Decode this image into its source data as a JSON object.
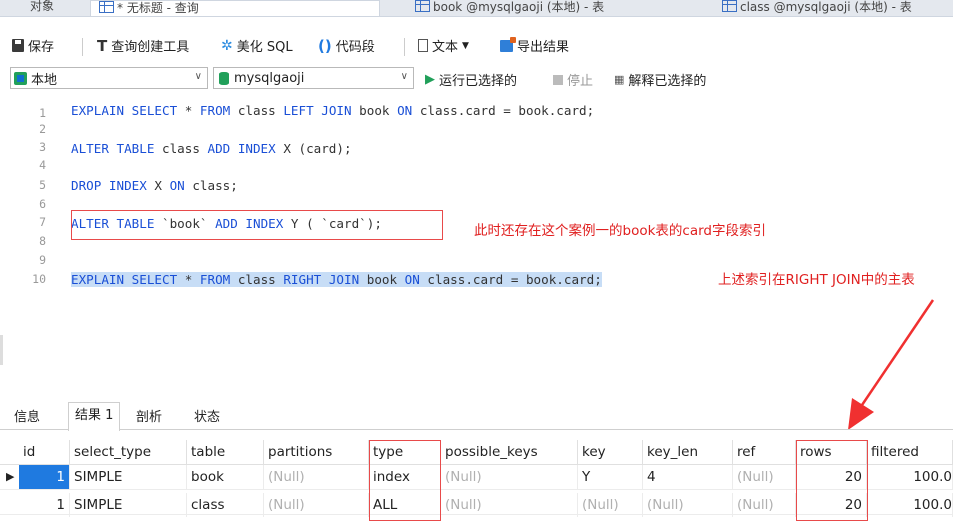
{
  "tabs": [
    {
      "label": "对象"
    },
    {
      "label": "* 无标题 - 查询"
    },
    {
      "label": "book @mysqlgaoji (本地) - 表"
    },
    {
      "label": "class @mysqlgaoji (本地) - 表"
    }
  ],
  "toolbar": {
    "save": "保存",
    "query_builder": "查询创建工具",
    "beautify": "美化 SQL",
    "snippet": "代码段",
    "text": "文本",
    "export": "导出结果"
  },
  "connbar": {
    "connection": "本地",
    "database": "mysqlgaoji",
    "run": "运行已选择的",
    "stop": "停止",
    "explain": "解释已选择的"
  },
  "editor": {
    "line_numbers": [
      "1",
      "2",
      "3",
      "4",
      "5",
      "6",
      "7",
      "8",
      "9",
      "10"
    ],
    "lines": {
      "l1": {
        "k1": "EXPLAIN SELECT",
        "t1": " * ",
        "k2": "FROM",
        "t2": " class ",
        "k3": "LEFT JOIN",
        "t3": " book ",
        "k4": "ON",
        "t4": " class.card = book.card;"
      },
      "l3": {
        "k1": "ALTER TABLE",
        "t1": " class ",
        "k2": "ADD INDEX",
        "t2": " X (card);"
      },
      "l5": {
        "k1": "DROP INDEX",
        "t1": " X ",
        "k2": "ON",
        "t2": " class;"
      },
      "l7": {
        "k1": "ALTER TABLE",
        "t1": " `book` ",
        "k2": "ADD INDEX",
        "t2": " Y ( `card`);"
      },
      "l10": {
        "k1": "EXPLAIN SELECT",
        "t1": " * ",
        "k2": "FROM",
        "t2": " class ",
        "k3": "RIGHT JOIN",
        "t3": " book ",
        "k4": "ON",
        "t4": " class.card = book.card;"
      }
    },
    "annotation1": "此时还存在这个案例一的book表的card字段索引",
    "annotation2": "上述索引在RIGHT JOIN中的主表"
  },
  "result_tabs": [
    "信息",
    "结果 1",
    "剖析",
    "状态"
  ],
  "grid": {
    "columns": [
      "id",
      "select_type",
      "table",
      "partitions",
      "type",
      "possible_keys",
      "key",
      "key_len",
      "ref",
      "rows",
      "filtered"
    ],
    "rows": [
      {
        "id": "1",
        "select_type": "SIMPLE",
        "table": "book",
        "partitions": "(Null)",
        "type": "index",
        "possible_keys": "(Null)",
        "key": "Y",
        "key_len": "4",
        "ref": "(Null)",
        "rows": "20",
        "filtered": "100.0"
      },
      {
        "id": "1",
        "select_type": "SIMPLE",
        "table": "class",
        "partitions": "(Null)",
        "type": "ALL",
        "possible_keys": "(Null)",
        "key": "(Null)",
        "key_len": "(Null)",
        "ref": "(Null)",
        "rows": "20",
        "filtered": "100.0"
      }
    ]
  },
  "colors": {
    "keyword": "#1a4fd6",
    "annotation": "#e02020",
    "selection": "#c7ddf6",
    "accent": "#1f7ae0"
  }
}
